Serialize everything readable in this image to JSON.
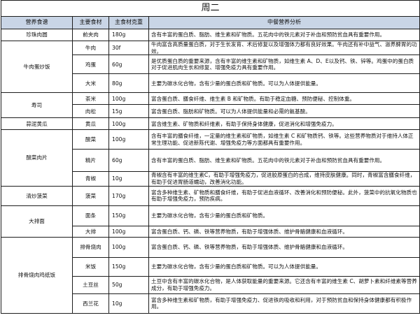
{
  "title": "周二",
  "headers": [
    "营养食谱",
    "主要食材",
    "主食材克重",
    "中餐营养分析"
  ],
  "dishes": [
    {
      "name": "珍珠肉圆",
      "items": [
        {
          "ingredient": "前夹肉",
          "weight": "180g",
          "analysis": "含有丰富的蛋白质、脂肪、维生素和矿物质。五花肉中的铁元素对于补血和预防贫血具有重要作用。"
        }
      ]
    },
    {
      "name": "牛肉蛋炒饭",
      "items": [
        {
          "ingredient": "牛肉",
          "weight": "30f",
          "analysis": "牛肉富含高质量蛋白质，对于生长发育、术后修复以及增强体力都有良好效果。牛肉还有补中益气、滋养脾胃的功效。"
        },
        {
          "ingredient": "鸡蛋",
          "weight": "60g",
          "analysis": "是优质蛋白质的重要来源，含有丰富的维生素和矿物质，如维生素 A、D、E以及钙、铁、锌等。鸡蛋中的蛋白质对于促进肌肉生长和修复、增强免疫力具有重要作用。"
        },
        {
          "ingredient": "大米",
          "weight": "80g",
          "analysis": "主要为碳水化合物，含有少量的蛋白质和矿物质。可以为人体提供能量。"
        }
      ]
    },
    {
      "name": "寿司",
      "items": [
        {
          "ingredient": "茶米",
          "weight": "100g",
          "analysis": "富含蛋白质、膳食纤维、维生素 B 和矿物质。有助于稳定血糖、预防便秘、控制体重。"
        },
        {
          "ingredient": "肉松",
          "weight": "15g",
          "analysis": "富含蛋白质、脂肪和矿物质。可以为人体提供能量和必需的氨基酸。"
        }
      ]
    },
    {
      "name": "蒜泥黄瓜",
      "items": [
        {
          "ingredient": "黄瓜",
          "weight": "100g",
          "analysis": "富含维生素、矿物质和纤维素，有助于保持身体健康，促进消化和增强免疫力。"
        }
      ]
    },
    {
      "name": "酸菜肉片",
      "items": [
        {
          "ingredient": "酸菜",
          "weight": "100g",
          "analysis": "含有丰富的膳食纤维，一定量的维生素和矿物质，如维生素 C 和矿物质钙、铁等。这些营养物质对于维持人体正常生理功能、促进新陈代谢、增强免疫力等方面都具有重要作用。"
        },
        {
          "ingredient": "精片",
          "weight": "60g",
          "analysis": "含有丰富的蛋白质、脂肪、维生素和矿物质。五花肉中的铁元素对于补血和预防贫血具有重要作用。"
        },
        {
          "ingredient": "青椒",
          "weight": "10g",
          "analysis": "青椒含有丰富的维生素C，有助于增强免疫力，促进胶原蛋白的合成，维持皮肤健康。同时，青椒富含膳食纤维，有助于促进胃肠道蠕动，改善消化功能。"
        }
      ]
    },
    {
      "name": "清炒菠菜",
      "items": [
        {
          "ingredient": "菠菜",
          "weight": "170g",
          "analysis": "富含多种维生素、矿物质和膳食纤维，有助于促进血液循环、改善消化和预防便秘。此外，菠菜中的抗氧化物质也有助于增强免疫力，预防疾病。"
        }
      ]
    },
    {
      "name": "大排面",
      "items": [
        {
          "ingredient": "面条",
          "weight": "150g",
          "analysis": "主要为碳水化合物，含有少量的蛋白质和矿物质。"
        },
        {
          "ingredient": "大排",
          "weight": "100g",
          "analysis": "富含蛋白质、钙、磷、铁等营养物质，有助于增强体质、维护骨骼健康和血液循环。"
        }
      ]
    },
    {
      "name": "排骨烧肉鸡纸饭",
      "items": [
        {
          "ingredient": "排骨烧肉",
          "weight": "100g",
          "analysis": "富含蛋白质、钙、磷、铁等营养物质，有助于增强体质、维护骨骼健康和血液循环。"
        },
        {
          "ingredient": "米饭",
          "weight": "150g",
          "analysis": "主要为碳水化合物，含有少量的蛋白质和矿物质。可以为人体提供能量。"
        },
        {
          "ingredient": "土豆丝",
          "weight": "50g",
          "analysis": "土豆中含有丰富的碳水化合物，是人体获取能量的重要来源。它还含有丰富的维生素 C、胡萝卜素和纤维素等营养成分，有助于增强免疫力。"
        },
        {
          "ingredient": "西兰花",
          "weight": "10g",
          "analysis": "富含多种维生素和矿物质，有助于增强免疫力、促进铁的吸收和利用，对于预防贫血和保持身体健康都有积极作用。"
        }
      ]
    }
  ]
}
